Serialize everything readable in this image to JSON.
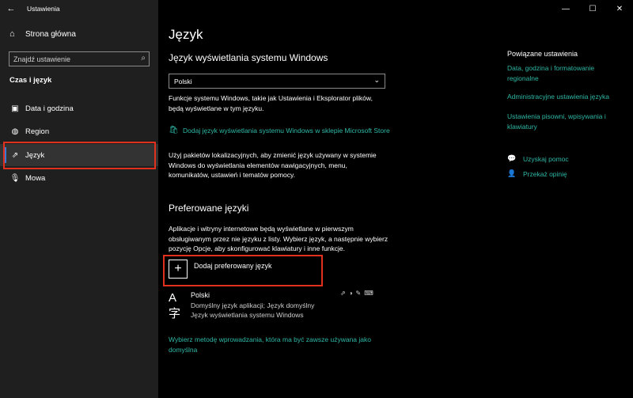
{
  "window": {
    "title": "Ustawienia",
    "back_icon": "←",
    "min_icon": "—",
    "max_icon": "☐",
    "close_icon": "✕"
  },
  "sidebar": {
    "home_label": "Strona główna",
    "search_placeholder": "Znajdź ustawienie",
    "section_title": "Czas i język",
    "items": [
      {
        "label": "Data i godzina",
        "icon": "calendar-clock-icon"
      },
      {
        "label": "Region",
        "icon": "globe-region-icon"
      },
      {
        "label": "Język",
        "icon": "language-icon"
      },
      {
        "label": "Mowa",
        "icon": "microphone-icon"
      }
    ]
  },
  "main": {
    "title": "Język",
    "display_heading": "Język wyświetlania systemu Windows",
    "display_value": "Polski",
    "display_desc": "Funkcje systemu Windows, takie jak Ustawienia i Eksplorator plików, będą wyświetlane w tym języku.",
    "store_link": "Dodaj język wyświetlania systemu Windows w sklepie Microsoft Store",
    "lip_desc": "Użyj pakietów lokalizacyjnych, aby zmienić język używany w systemie Windows do wyświetlania elementów nawigacyjnych, menu, komunikatów, ustawień i tematów pomocy.",
    "pref_heading": "Preferowane języki",
    "pref_desc": "Aplikacje i witryny internetowe będą wyświetlane w pierwszym obsługiwanym przez nie języku z listy. Wybierz język, a następnie wybierz pozycję Opcje, aby skonfigurować klawiatury i inne funkcje.",
    "add_label": "Dodaj preferowany język",
    "lang_name": "Polski",
    "lang_desc1": "Domyślny język aplikacji; Język domyślny",
    "lang_desc2": "Język wyświetlania systemu Windows",
    "input_method_link": "Wybierz metodę wprowadzania, która ma być zawsze używana jako domyślna"
  },
  "related": {
    "heading": "Powiązane ustawienia",
    "links": [
      "Data, godzina i formatowanie regionalne",
      "Administracyjne ustawienia języka",
      "Ustawienia pisowni, wpisywania i klawiatury"
    ],
    "help": "Uzyskaj pomoc",
    "feedback": "Przekaż opinię"
  },
  "colors": {
    "accent_link": "#2eb8a6",
    "highlight_box": "#e0301e",
    "sidebar_bg": "#1f1f1f"
  }
}
